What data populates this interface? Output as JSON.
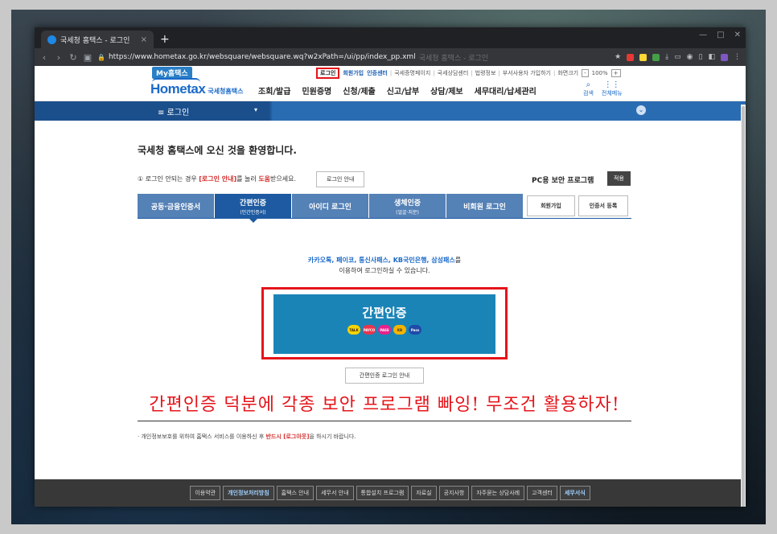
{
  "browser": {
    "tab_title": "국세청 홈택스 - 로그인",
    "tab_close": "×",
    "new_tab": "+",
    "window_controls": [
      "—",
      "□",
      "✕"
    ],
    "url_host": "https://www.hometax.go.kr/websquare/websquare.wq?w2xPath=/ui/pp/index_pp.xml",
    "url_faded_title": "국세청 홈택스 - 로그인"
  },
  "util": {
    "my_hometax": "My홈택스",
    "links": [
      "로그인",
      "회원가입",
      "인증센터",
      "국세증명페이지",
      "국세상담센터",
      "법령정보",
      "부서사용자 가입하기",
      "화면크기"
    ],
    "zoom_minus": "-",
    "zoom": "100%",
    "zoom_plus": "+"
  },
  "gnb": {
    "logo": "Hometax",
    "logo_sub": "국세청홈택스",
    "menu": [
      "조회/발급",
      "민원증명",
      "신청/제출",
      "신고/납부",
      "상담/제보",
      "세무대리/납세관리"
    ],
    "search": "검색",
    "all_menu": "전체메뉴"
  },
  "lnb": {
    "title": "≡  로그인",
    "arrow": "▾"
  },
  "main": {
    "welcome": "국세청 홈택스에 오신 것을 환영합니다.",
    "notice_prefix": "① 로그인 안되는 경우 ",
    "notice_red": "[로그인 안내]",
    "notice_mid": "를 눌러 ",
    "notice_red2": "도움",
    "notice_suffix": "받으세요.",
    "guide_button": "로그인 안내",
    "pc_security": "PC용 보안 프로그램",
    "apply_button": "적용",
    "tabs": [
      {
        "label": "공동·금융인증서",
        "sub": ""
      },
      {
        "label": "간편인증",
        "sub": "(민간인증서)"
      },
      {
        "label": "아이디 로그인",
        "sub": ""
      },
      {
        "label": "생체인증",
        "sub": "(얼굴·지문)"
      },
      {
        "label": "비회원 로그인",
        "sub": ""
      }
    ],
    "signup_button": "회원가입",
    "cert_register_button": "인증서 등록",
    "providers_text": "카카오톡, 페이코, 통신사패스, KB국민은행, 삼성패스",
    "providers_suffix": "를",
    "desc_line2": "이용하여 로그인하실 수 있습니다.",
    "easy_auth_button": "간편인증",
    "provider_icons": [
      {
        "name": "kakao",
        "text": "TALK",
        "color": "#f7d400"
      },
      {
        "name": "payco",
        "text": "PAYCO",
        "color": "#e8344e"
      },
      {
        "name": "pass",
        "text": "PASS",
        "color": "#e8218c"
      },
      {
        "name": "kb",
        "text": "KB",
        "color": "#f5b400"
      },
      {
        "name": "samsung-pass",
        "text": "Pass",
        "color": "#1f4aa8"
      }
    ],
    "easy_guide_button": "간편인증 로그인 안내",
    "caption": "간편인증 덕분에 각종 보안 프로그램 빠잉! 무조건 활용하자!",
    "privacy_prefix": "· 개인정보보호를 위하여 홈택스 서비스를 이용하신 후 ",
    "privacy_red": "반드시 [로그아웃]",
    "privacy_suffix": "을 하시기 바랍니다."
  },
  "footer": {
    "links": [
      "이용약관",
      "개인정보처리방침",
      "홈택스 안내",
      "세무서 안내",
      "통합설치 프로그램",
      "자료실",
      "공지사항",
      "자주묻는 상담사례",
      "고객센터",
      "세무서식"
    ]
  }
}
